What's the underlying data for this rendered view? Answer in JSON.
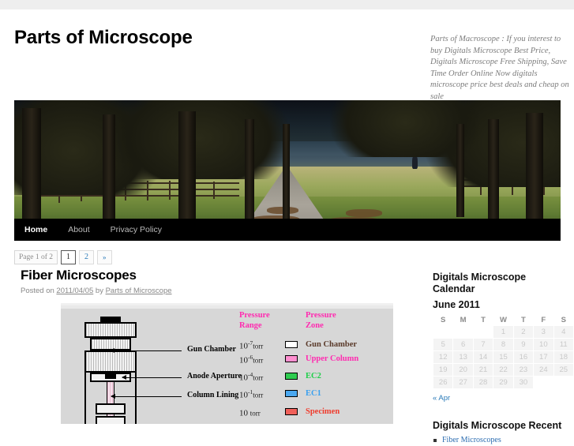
{
  "site": {
    "title": "Parts of Microscope",
    "description": "Parts of Macroscope :  If you interest to buy Digitals Microscope Best Price, Digitals Microscope Free Shipping, Save Time Order Online Now digitals microscope price best deals and cheap on sale"
  },
  "nav": {
    "items": [
      {
        "label": "Home",
        "current": true
      },
      {
        "label": "About",
        "current": false
      },
      {
        "label": "Privacy Policy",
        "current": false
      }
    ]
  },
  "pagination": {
    "status": "Page 1 of 2",
    "page_current": "1",
    "page_two": "2",
    "next": "»"
  },
  "post": {
    "title": "Fiber Microscopes",
    "meta_prefix": "Posted on ",
    "date": "2011/04/05",
    "meta_by": " by ",
    "author": "Parts of Microscope"
  },
  "figure": {
    "labels": {
      "gun_chamber": "Gun Chamber",
      "anode_aperture": "Anode Aperture",
      "column_lining": "Column Lining"
    },
    "table": {
      "head_range": "Pressure Range",
      "head_range_line1": "Pressure",
      "head_range_line2": "Range",
      "head_zone_line1": "Pressure",
      "head_zone_line2": "Zone",
      "rows": [
        {
          "exp": "-7",
          "base": "10",
          "unit": "torr",
          "zone": "Gun Chamber",
          "zone_color": "#5a3a2a",
          "swatch": "#ffffff"
        },
        {
          "exp": "-6",
          "base": "10",
          "unit": "torr",
          "zone": "Upper Column",
          "zone_color": "#ff2bb0",
          "swatch": "#ff8fd0"
        },
        {
          "exp": "-4",
          "base": "10",
          "unit": "torr",
          "zone": "EC2",
          "zone_color": "#1fcf4a",
          "swatch": "#2ecc50"
        },
        {
          "exp": "-1",
          "base": "10",
          "unit": "torr",
          "zone": "EC1",
          "zone_color": "#3aa0ef",
          "swatch": "#4aa8f0"
        },
        {
          "exp": "",
          "base": "10",
          "unit": "torr",
          "zone": "Specimen",
          "zone_color": "#ef3b2c",
          "swatch": "#f0605a"
        }
      ]
    }
  },
  "sidebar": {
    "calendar": {
      "title_line1": "Digitals Microscope",
      "title_line2": "Calendar",
      "caption": "June 2011",
      "weekdays": [
        "S",
        "M",
        "T",
        "W",
        "T",
        "F",
        "S"
      ],
      "weeks": [
        [
          "",
          "",
          "",
          "1",
          "2",
          "3",
          "4"
        ],
        [
          "5",
          "6",
          "7",
          "8",
          "9",
          "10",
          "11"
        ],
        [
          "12",
          "13",
          "14",
          "15",
          "16",
          "17",
          "18"
        ],
        [
          "19",
          "20",
          "21",
          "22",
          "23",
          "24",
          "25"
        ],
        [
          "26",
          "27",
          "28",
          "29",
          "30",
          "",
          ""
        ]
      ],
      "prev_link": "« Apr"
    },
    "recent": {
      "title": "Digitals Microscope Recent",
      "items": [
        {
          "label": "Fiber Microscopes"
        }
      ]
    }
  },
  "colors": {
    "link": "#2b7bb9",
    "nav_bg": "#000000",
    "figure_bg": "#d7d7d7",
    "accent_pink": "#ff2bb0"
  }
}
